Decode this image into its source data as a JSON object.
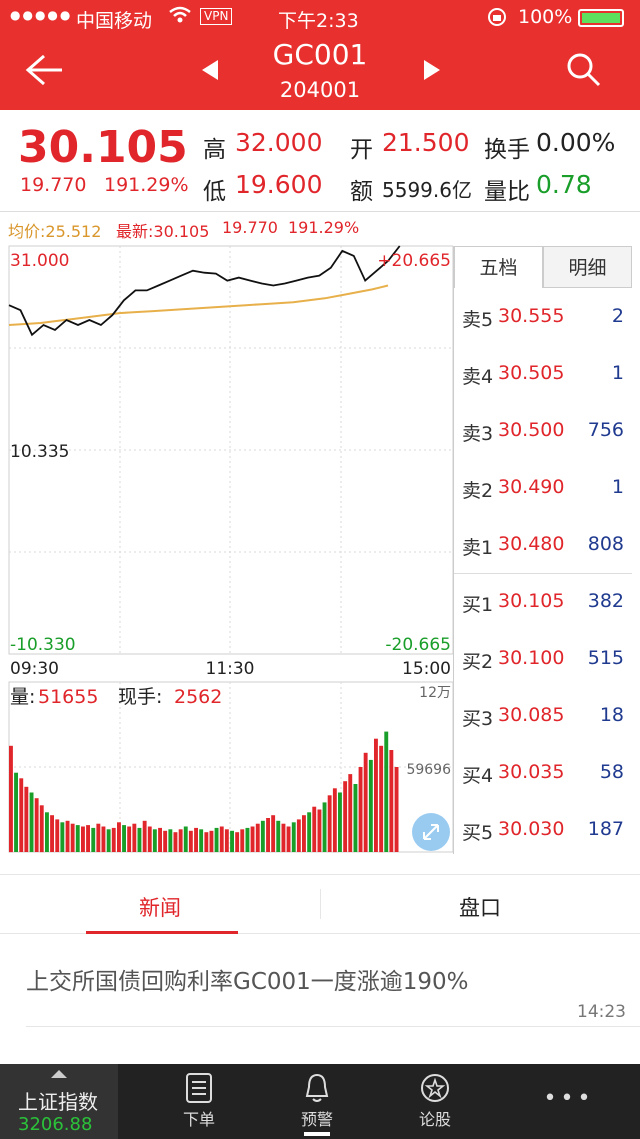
{
  "status": {
    "carrier": "中国移动",
    "vpn": "VPN",
    "time": "下午2:33",
    "battery": "100%"
  },
  "nav": {
    "code": "GC001",
    "subcode": "204001"
  },
  "quote": {
    "price": "30.105",
    "change": "19.770",
    "change_pct": "191.29%",
    "high_label": "高",
    "high": "32.000",
    "low_label": "低",
    "low": "19.600",
    "open_label": "开",
    "open": "21.500",
    "amount_label": "额",
    "amount": "5599.6亿",
    "turnover_label": "换手",
    "turnover": "0.00%",
    "volratio_label": "量比",
    "volratio": "0.78"
  },
  "info": {
    "avg": "均价:25.512",
    "latest": "最新:30.105",
    "change": "19.770",
    "change_pct": "191.29%"
  },
  "chart_labels": {
    "y_top_left": "31.000",
    "y_top_right": "+20.665",
    "y_mid": "10.335",
    "y_bottom_left": "-10.330",
    "y_bottom_right": "-20.665",
    "t_start": "09:30",
    "t_mid": "11:30",
    "t_end": "15:00",
    "vol_label": "量:",
    "vol_value": "51655",
    "hand_label": "现手:",
    "hand_value": "2562",
    "vol_max": "12万",
    "vol_mid": "59696"
  },
  "chart_data": {
    "type": "line",
    "x_axis": [
      "09:30",
      "11:30",
      "15:00"
    ],
    "ylim": [
      -10.33,
      31.0
    ],
    "series": [
      {
        "values": [
          25.0,
          24.5,
          22.0,
          23.0,
          22.5,
          23.5,
          23.0,
          23.5,
          23.0,
          24.0,
          25.5,
          26.5,
          26.5,
          27.0,
          27.5,
          28.0,
          28.5,
          28.3,
          28.2,
          27.5,
          27.8,
          27.5,
          27.2,
          27.0,
          27.2,
          27.5,
          27.8,
          28.0,
          28.8,
          30.5,
          30.0,
          27.5,
          28.5,
          29.5,
          31.0
        ]
      },
      {
        "values": [
          23.0,
          23.1,
          23.2,
          23.4,
          23.6,
          23.8,
          24.0,
          24.2,
          24.3,
          24.4,
          24.5,
          24.6,
          24.7,
          24.8,
          24.9,
          25.0,
          25.1,
          25.2,
          25.3,
          25.5,
          25.7,
          26.0,
          26.3,
          26.6,
          27.0
        ]
      }
    ],
    "volume_ylim": [
      0,
      120000
    ],
    "volume": [
      75000,
      56000,
      52000,
      46000,
      42000,
      38000,
      33000,
      28000,
      26000,
      23000,
      21000,
      22000,
      20000,
      19000,
      18000,
      19000,
      17000,
      20000,
      18000,
      16000,
      17000,
      21000,
      19000,
      18000,
      20000,
      17000,
      22000,
      18000,
      16000,
      17000,
      15000,
      16000,
      14000,
      16000,
      18000,
      15000,
      17000,
      16000,
      14000,
      15000,
      17000,
      18000,
      16000,
      15000,
      14000,
      16000,
      17000,
      18000,
      20000,
      22000,
      24000,
      26000,
      22000,
      20000,
      18000,
      21000,
      23000,
      26000,
      28000,
      32000,
      30000,
      35000,
      40000,
      45000,
      42000,
      50000,
      55000,
      48000,
      60000,
      70000,
      65000,
      80000,
      75000,
      85000,
      72000,
      60000
    ]
  },
  "orderbook": {
    "tabs": [
      "五档",
      "明细"
    ],
    "rows": [
      {
        "label": "卖5",
        "price": "30.555",
        "vol": "2"
      },
      {
        "label": "卖4",
        "price": "30.505",
        "vol": "1"
      },
      {
        "label": "卖3",
        "price": "30.500",
        "vol": "756"
      },
      {
        "label": "卖2",
        "price": "30.490",
        "vol": "1"
      },
      {
        "label": "卖1",
        "price": "30.480",
        "vol": "808"
      },
      {
        "label": "买1",
        "price": "30.105",
        "vol": "382"
      },
      {
        "label": "买2",
        "price": "30.100",
        "vol": "515"
      },
      {
        "label": "买3",
        "price": "30.085",
        "vol": "18"
      },
      {
        "label": "买4",
        "price": "30.035",
        "vol": "58"
      },
      {
        "label": "买5",
        "price": "30.030",
        "vol": "187"
      }
    ]
  },
  "tabs2": {
    "news": "新闻",
    "book": "盘口"
  },
  "news": {
    "items": [
      {
        "title": "上交所国债回购利率GC001一度涨逾190%",
        "time": "14:23"
      }
    ]
  },
  "bottombar": {
    "index_name": "上证指数",
    "index_value": "3206.88",
    "items": [
      "下单",
      "预警",
      "论股"
    ]
  },
  "colors": {
    "brand": "#e8302e",
    "up": "#e0262b",
    "down": "#1a9e2a",
    "avgline": "#e8b04a"
  }
}
